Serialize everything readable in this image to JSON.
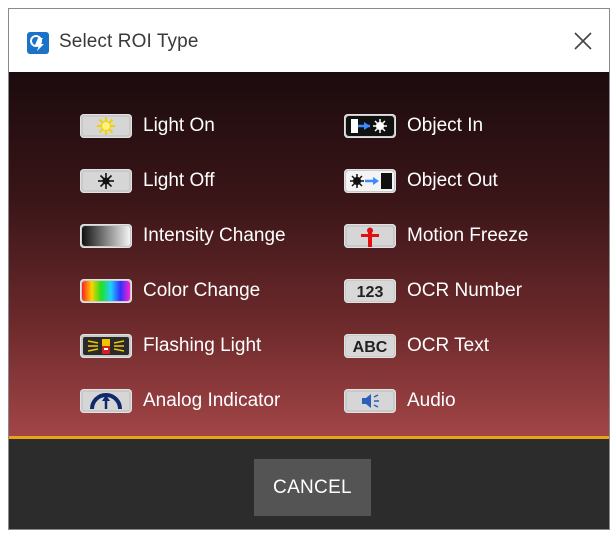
{
  "window": {
    "title": "Select ROI Type",
    "app_icon": "app-logo-icon",
    "close_icon": "close-icon"
  },
  "roi_types": {
    "left": [
      {
        "label": "Light On",
        "icon": "light-on-icon"
      },
      {
        "label": "Light Off",
        "icon": "light-off-icon"
      },
      {
        "label": "Intensity Change",
        "icon": "intensity-gradient-icon"
      },
      {
        "label": "Color Change",
        "icon": "color-spectrum-icon"
      },
      {
        "label": "Flashing Light",
        "icon": "flashing-light-icon"
      },
      {
        "label": "Analog Indicator",
        "icon": "gauge-icon"
      }
    ],
    "right": [
      {
        "label": "Object In",
        "icon": "object-in-icon"
      },
      {
        "label": "Object Out",
        "icon": "object-out-icon"
      },
      {
        "label": "Motion Freeze",
        "icon": "motion-freeze-icon"
      },
      {
        "label": "OCR Number",
        "icon": "ocr-number-icon",
        "badge": "123"
      },
      {
        "label": "OCR Text",
        "icon": "ocr-text-icon",
        "badge": "ABC"
      },
      {
        "label": "Audio",
        "icon": "speaker-icon"
      }
    ]
  },
  "footer": {
    "cancel_label": "CANCEL"
  },
  "colors": {
    "divider": "#e4a51b",
    "footer_bg": "#2c2c2c",
    "button_bg": "#545454",
    "content_top": "#1b0b0d",
    "content_bottom": "#a24547",
    "app_icon_blue": "#1a73c8"
  }
}
